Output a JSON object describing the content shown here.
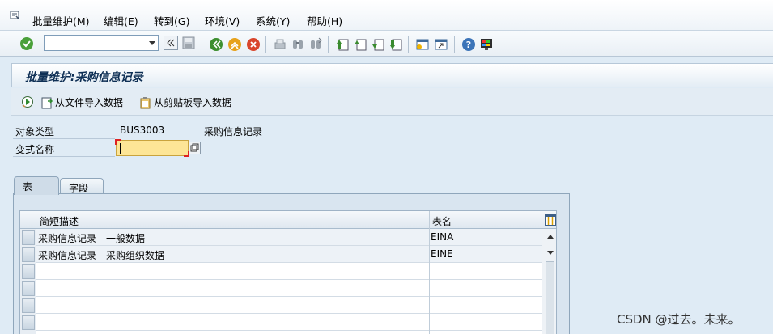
{
  "menu": {
    "items": [
      "批量维护(M)",
      "编辑(E)",
      "转到(G)",
      "环境(V)",
      "系统(Y)",
      "帮助(H)"
    ]
  },
  "toolbar": {
    "command_value": ""
  },
  "screen": {
    "title": "批量维护:采购信息记录"
  },
  "app_toolbar": {
    "import_file_label": "从文件导入数据",
    "import_clipboard_label": "从剪贴板导入数据"
  },
  "form": {
    "object_type_label": "对象类型",
    "object_type_value": "BUS3003",
    "object_type_desc": "采购信息记录",
    "variant_label": "变式名称",
    "variant_value": ""
  },
  "tabs": [
    {
      "label": "表",
      "active": true
    },
    {
      "label": "字段",
      "active": false
    }
  ],
  "table": {
    "columns": [
      "简短描述",
      "表名"
    ],
    "rows": [
      {
        "desc": "采购信息记录 - 一般数据",
        "name": "EINA"
      },
      {
        "desc": "采购信息记录 - 采购组织数据",
        "name": "EINE"
      }
    ]
  },
  "watermark": "CSDN @过去。未来。",
  "colors": {
    "background": "#dfebf5",
    "title": "#0e2f55",
    "required_field": "#fde596"
  }
}
